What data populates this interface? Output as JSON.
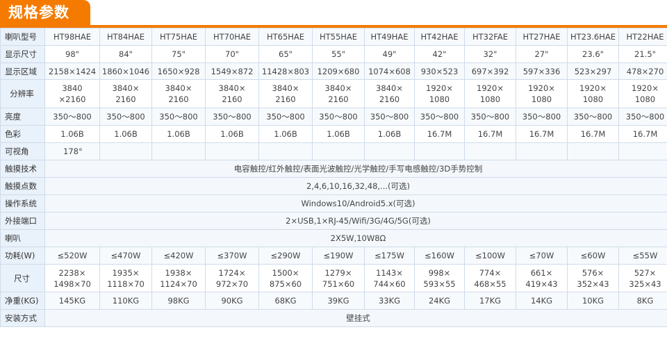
{
  "title": "规格参数",
  "models": [
    "HT98HAE",
    "HT84HAE",
    "HT75HAE",
    "HT70HAE",
    "HT65HAE",
    "HT55HAE",
    "HT49HAE",
    "HT42HAE",
    "HT32FAE",
    "HT27HAE",
    "HT23.6HAE",
    "HT22HAE"
  ],
  "labels": {
    "model": "喇叭型号",
    "size": "显示尺寸",
    "area": "显示区域",
    "resolution": "分辨率",
    "brightness": "亮度",
    "color": "色彩",
    "viewing_angle": "可视角",
    "touch_tech": "触摸技术",
    "touch_points": "触摸点数",
    "os": "操作系统",
    "ports": "外接端口",
    "speaker": "喇叭",
    "power": "功耗(W)",
    "dimensions": "尺寸",
    "weight": "净重(KG)",
    "mounting": "安装方式"
  },
  "sizes": [
    "98\"",
    "84\"",
    "75\"",
    "70\"",
    "65\"",
    "55\"",
    "49\"",
    "42\"",
    "32\"",
    "27\"",
    "23.6\"",
    "21.5\""
  ],
  "areas": [
    "2158×1424",
    "1860×1046",
    "1650×928",
    "1549×872",
    "11428×803",
    "1209×680",
    "1074×608",
    "930×523",
    "697×392",
    "597×336",
    "523×297",
    "478×270"
  ],
  "resolutions": [
    "3840\n×2160",
    "3840×\n2160",
    "3840×\n2160",
    "3840×\n2160",
    "3840×\n2160",
    "3840×\n2160",
    "3840×\n2160",
    "1920×\n1080",
    "1920×\n1080",
    "1920×\n1080",
    "1920×\n1080",
    "1920×\n1080"
  ],
  "brightness": [
    "350～800",
    "350～800",
    "350～800",
    "350～800",
    "350～800",
    "350～800",
    "350～800",
    "350～800",
    "350～800",
    "350～800",
    "350～800",
    "350～800"
  ],
  "colors": [
    "1.06B",
    "1.06B",
    "1.06B",
    "1.06B",
    "1.06B",
    "1.06B",
    "1.06B",
    "16.7M",
    "16.7M",
    "16.7M",
    "16.7M",
    "16.7M"
  ],
  "viewing_angle": "178°",
  "touch_tech": "电容触控/红外触控/表面光波触控/光学触控/手写电感触控/3D手势控制",
  "touch_points": "2,4,6,10,16,32,48,...(可选)",
  "os": "Windows10/Android5.x(可选)",
  "ports": "2×USB,1×RJ-45/Wifi/3G/4G/5G(可选)",
  "speaker": "2X5W,10W8Ω",
  "power": [
    "≤520W",
    "≤470W",
    "≤420W",
    "≤370W",
    "≤290W",
    "≤190W",
    "≤175W",
    "≤160W",
    "≤100W",
    "≤70W",
    "≤60W",
    "≤55W"
  ],
  "dimensions": [
    "2238×\n1498×70",
    "1935×\n1118×70",
    "1938×\n1124×70",
    "1724×\n972×70",
    "1500×\n875×60",
    "1279×\n751×60",
    "1143×\n744×60",
    "998×\n593×55",
    "774×\n468×55",
    "661×\n419×43",
    "576×\n352×43",
    "527×\n325×43"
  ],
  "weights": [
    "145KG",
    "110KG",
    "98KG",
    "90KG",
    "68KG",
    "39KG",
    "33KG",
    "24KG",
    "17KG",
    "14KG",
    "10KG",
    "8KG"
  ],
  "mounting": "壁挂式",
  "colors_theme": {
    "accent": "#f57b00",
    "label_bg": "#e9f1fa",
    "border": "#cfdbe8"
  }
}
